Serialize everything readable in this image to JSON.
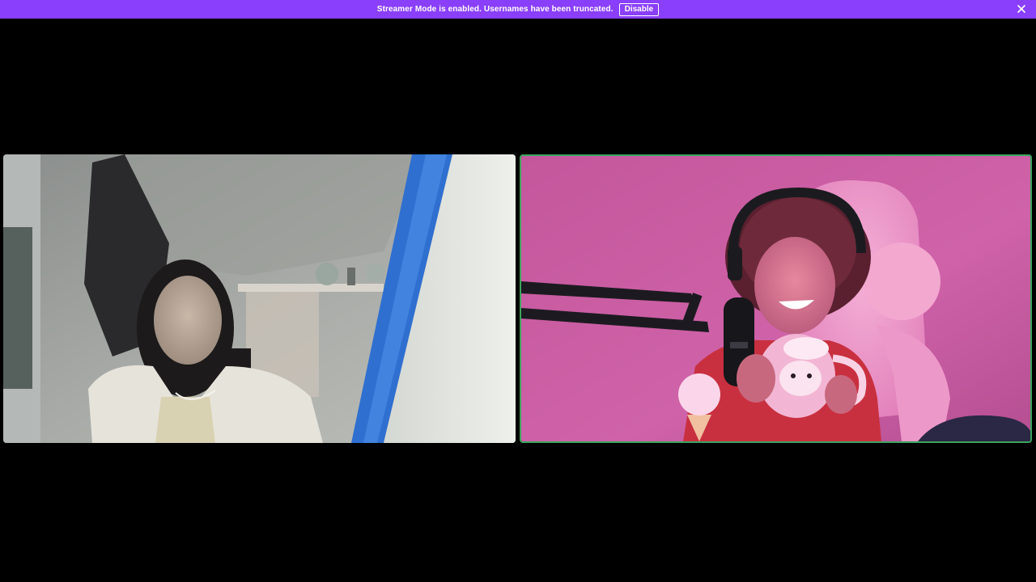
{
  "banner": {
    "message": "Streamer Mode is enabled. Usernames have been truncated.",
    "disable_label": "Disable",
    "close_icon": "close-icon",
    "background": "#8a3ffc"
  },
  "tiles": [
    {
      "id": "participant-1",
      "speaking": false
    },
    {
      "id": "participant-2",
      "speaking": true,
      "speaking_color": "#3ba55d"
    }
  ],
  "colors": {
    "background": "#000000",
    "banner": "#8a3ffc",
    "speaking_ring": "#3ba55d"
  }
}
